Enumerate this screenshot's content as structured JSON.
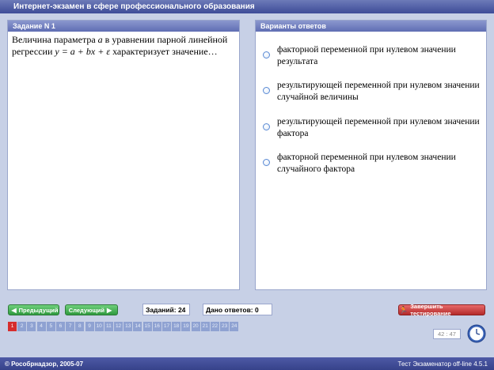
{
  "window": {
    "title": "Интернет-экзамен в сфере профессионального образования"
  },
  "task_panel": {
    "header": "Задание N 1",
    "question_part1": "Величина параметра",
    "question_param": "a",
    "question_part2": "в уравнении парной линейной регрессии",
    "question_formula": "y = a + bx + ε",
    "question_part3": "характеризует значение…"
  },
  "answers_panel": {
    "header": "Варианты ответов",
    "options": [
      {
        "text": "факторной переменной при нулевом значении результата"
      },
      {
        "text": "результирующей переменной при нулевом значении случайной величины"
      },
      {
        "text": "результирующей переменной при нулевом значении фактора"
      },
      {
        "text": "факторной переменной при нулевом значении случайного фактора"
      }
    ]
  },
  "nav": {
    "prev_label": "Предыдущий",
    "next_label": "Следующий",
    "tasks_count": "Заданий: 24",
    "answers_given": "Дано ответов: 0",
    "finish_label": "Завершить тестирование"
  },
  "question_numbers": [
    "1",
    "2",
    "3",
    "4",
    "5",
    "6",
    "7",
    "8",
    "9",
    "10",
    "11",
    "12",
    "13",
    "14",
    "15",
    "16",
    "17",
    "18",
    "19",
    "20",
    "21",
    "22",
    "23",
    "24"
  ],
  "active_question": "1",
  "timer": {
    "minutes": "42",
    "seconds": "47"
  },
  "footer": {
    "copyright": "© Рособрнадзор, 2005-07",
    "version": "Тест Экзаменатор off-line 4.5.1"
  },
  "colors": {
    "background": "#c7d0e6",
    "header_blue": "#5f6db3",
    "button_green": "#2f9a3e",
    "button_red": "#b42a2a",
    "active_number": "#d62d2d"
  }
}
